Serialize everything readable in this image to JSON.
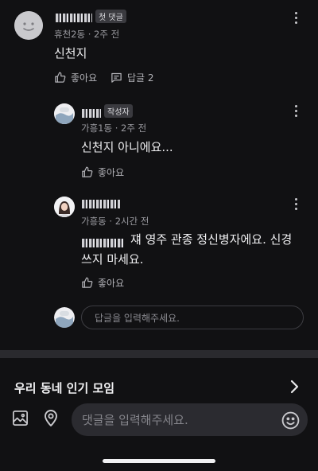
{
  "comment1": {
    "badge": "첫 댓글",
    "meta": "휴천2동 · 2주 전",
    "text": "신천지",
    "like_label": "좋아요",
    "reply_label": "답글 2"
  },
  "reply1": {
    "badge": "작성자",
    "meta": "가흥1동 · 2주 전",
    "text": "신천지 아니에요...",
    "like_label": "좋아요"
  },
  "reply2": {
    "meta": "가흥동 · 2시간 전",
    "text_line1": "쟤 영주 관종 정신병자에요. 신경",
    "text_line2": "쓰지 마세요.",
    "like_label": "좋아요"
  },
  "reply_input": {
    "placeholder": "답글을 입력해주세요."
  },
  "section": {
    "title": "우리 동네 인기 모임"
  },
  "comment_bar": {
    "placeholder": "댓글을 입력해주세요."
  }
}
